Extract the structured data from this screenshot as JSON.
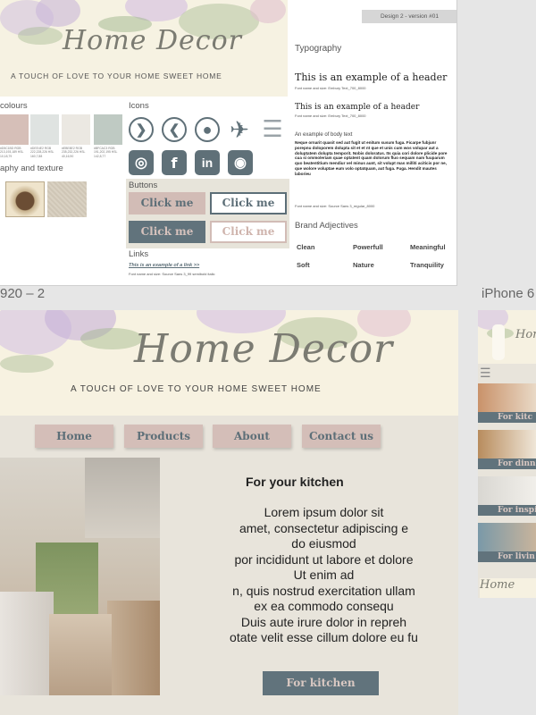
{
  "guide": {
    "version": "Design 2 - version #01",
    "brand": "Home Decor",
    "tagline": "A TOUCH OF LOVE TO YOUR HOME SWEET HOME",
    "colours_title": "colours",
    "swatches": [
      {
        "color": "#d6bfb8",
        "code": "#D5C1BD RGB 213,193,189 HSL 10,18,79"
      },
      {
        "color": "#dfe3e1",
        "code": "#DEE4E2 RGB 222,228,226 HSL 160,7,88"
      },
      {
        "color": "#ebe8e2",
        "code": "#EBE8E2 RGB 235,232,226 HSL 40,16,90"
      },
      {
        "color": "#bfcac3",
        "code": "#BFCAC3 RGB 191,202,195 HSL 142,8,77"
      }
    ],
    "texture_title": "aphy and texture",
    "icons_title": "Icons",
    "icons": [
      {
        "name": "chevron-right-icon",
        "glyph": "❯"
      },
      {
        "name": "chevron-left-icon",
        "glyph": "❮"
      },
      {
        "name": "user-icon",
        "glyph": "●"
      },
      {
        "name": "airplane-icon",
        "glyph": "✈"
      },
      {
        "name": "hamburger-icon",
        "glyph": "☰"
      },
      {
        "name": "instagram-icon",
        "glyph": "◎"
      },
      {
        "name": "facebook-icon",
        "glyph": "f"
      },
      {
        "name": "linkedin-icon",
        "glyph": "in"
      },
      {
        "name": "github-icon",
        "glyph": "◉"
      }
    ],
    "buttons_title": "Buttons",
    "click_me": "Click me",
    "links_title": "Links",
    "link_example": "This is an example of a link >>",
    "link_font": "Font name and size: Source Sans 3_99 semibold italic",
    "typography_title": "Typography",
    "header1": "This is an example of a header",
    "header1_font": "Font name and size: Embury Text_700_8000",
    "header2": "This is an example of a header",
    "header2_font": "Font name and size: Embury Text_700_8000",
    "body_label": "An example of body text",
    "body_text": "Neque ornarit quasit sed aut fugit ut enitum susum fuga. Ficarpe fubjunr porepnu doloporem dolupta sit et et nt que et unis cum wos volupar aut a doluptatem dolupta temporit. Nobis doloratus. Its quia cori dolore plicide pore cua si ommoleriam quae optatent quam dolorum fluo sequam nam fuuparum quo beatentitium mendiur vel minus aunt, sit volupt mas milliti aciticis por ne, que wolore voluptae eum volo optatquam, aut fuga. Fuga. Hendit mautes laborieu",
    "body_font": "Font name and size: Source Sans 3_regular_8000",
    "adjectives_title": "Brand Adjectives",
    "adjectives": [
      "Clean",
      "Powerfull",
      "Meaningful",
      "Soft",
      "Nature",
      "Tranquility"
    ]
  },
  "desktop": {
    "label": "920 – 2",
    "brand": "Home Decor",
    "tagline": "A TOUCH OF LOVE TO YOUR HOME SWEET HOME",
    "nav": [
      "Home",
      "Products",
      "About",
      "Contact us"
    ],
    "heading": "For your kitchen",
    "lorem_lines": [
      "Lorem ipsum dolor sit",
      "amet, consectetur adipiscing e",
      "do eiusmod",
      "por incididunt ut labore et dolore",
      "Ut enim ad",
      "n, quis nostrud exercitation ullam",
      "ex ea commodo consequ",
      "Duis aute irure dolor in repreh",
      "otate velit esse cillum dolore eu fu"
    ],
    "cta": "For kitchen"
  },
  "iphone": {
    "label": "iPhone 6",
    "brand": "Home",
    "categories": [
      "For kitc",
      "For dinnin",
      "For inspi",
      "For livin"
    ]
  }
}
